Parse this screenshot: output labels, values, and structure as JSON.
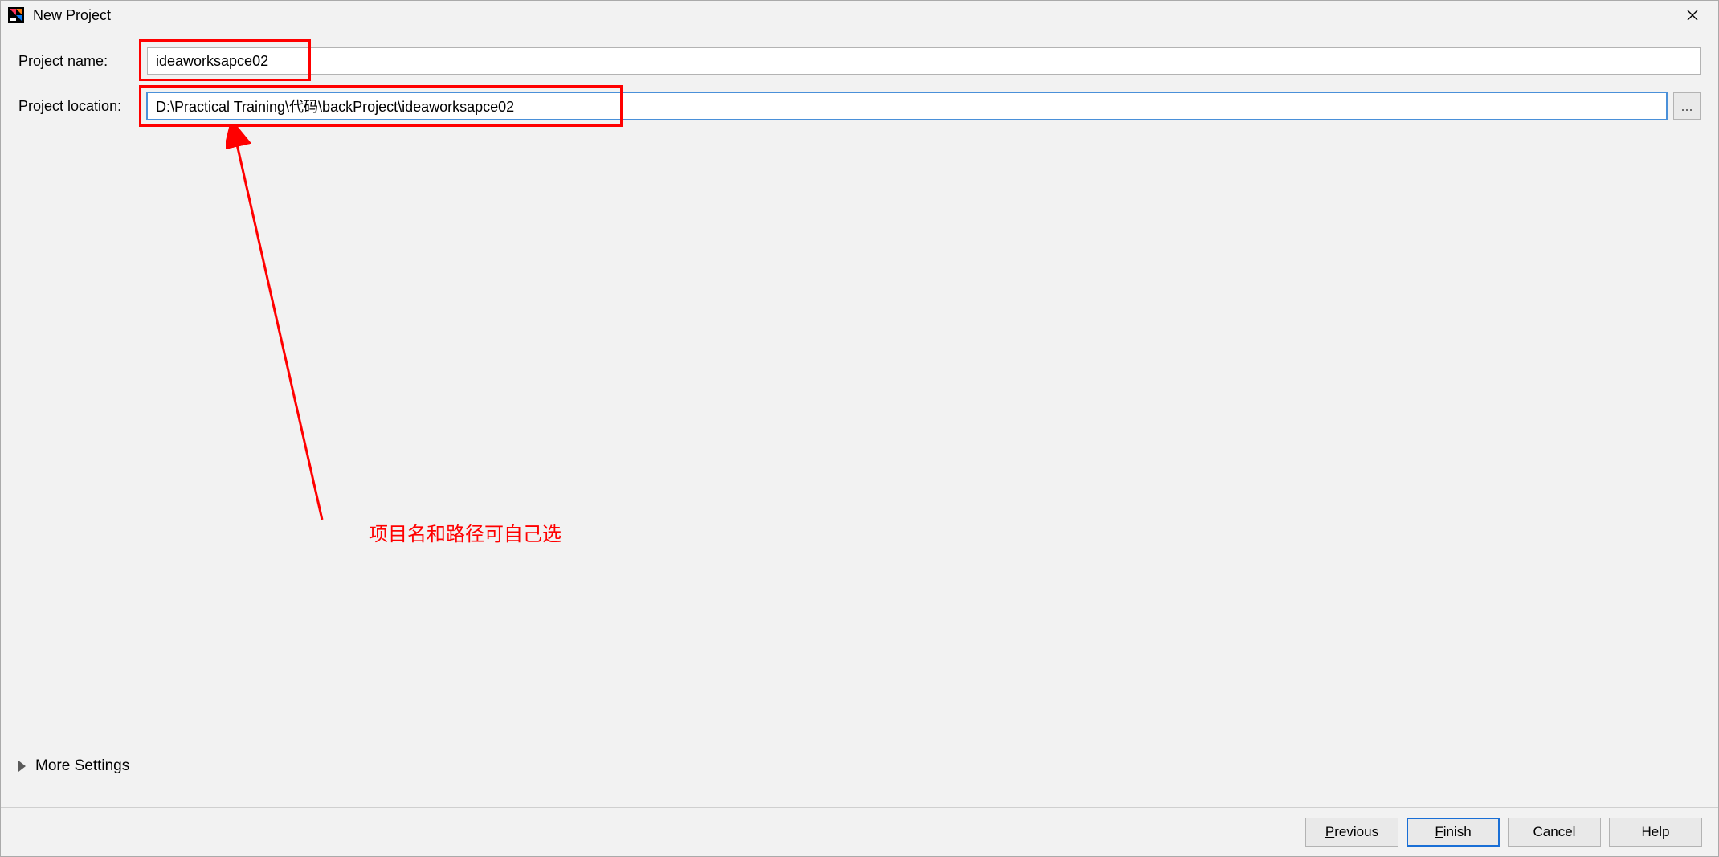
{
  "window": {
    "title": "New Project"
  },
  "form": {
    "project_name_label_pre": "Project ",
    "project_name_label_ul": "n",
    "project_name_label_post": "ame:",
    "project_name_value": "ideaworksapce02",
    "project_location_label_pre": "Project ",
    "project_location_label_ul": "l",
    "project_location_label_post": "ocation:",
    "project_location_value": "D:\\Practical Training\\代码\\backProject\\ideaworksapce02",
    "browse_label": "..."
  },
  "more_settings": {
    "label_pre": "Mor",
    "label_ul": "e",
    "label_post": " Settings"
  },
  "annotation": {
    "text": "项目名和路径可自己选"
  },
  "buttons": {
    "previous_ul": "P",
    "previous_post": "revious",
    "finish_ul": "F",
    "finish_post": "inish",
    "cancel": "Cancel",
    "help": "Help"
  }
}
